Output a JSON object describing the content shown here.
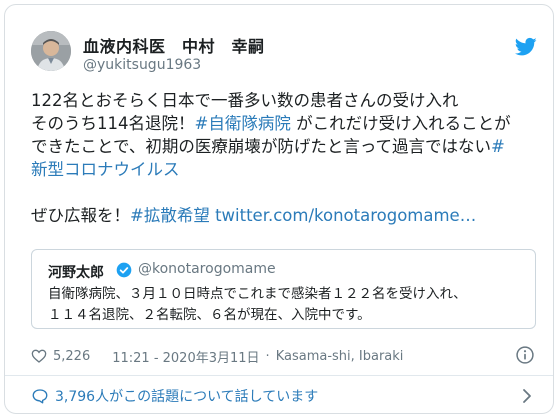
{
  "author": {
    "name": "血液内科医　中村　幸嗣",
    "handle": "@yukitsugu1963"
  },
  "tweet": {
    "line1": "122名とおそらく日本で一番多い数の患者さんの受け入れ",
    "line2_prefix": "そのうち114名退院！",
    "line2_hashtag": "#自衛隊病院",
    "line2_suffix": " がこれだけ受け入れることが",
    "line3_text": "できたことで、初期の医療崩壊が防げたと言って過言ではない",
    "line3_hashtag": "#",
    "line4_hashtag": "新型コロナウイルス",
    "line5_prefix": "ぜひ広報を！",
    "line5_hashtag": "#拡散希望",
    "line5_link": " twitter.com/konotarogomame…"
  },
  "quote": {
    "name": "河野太郎",
    "handle": "@konotarogomame",
    "line1": "自衛隊病院、３月１０日時点でこれまで感染者１２２名を受け入れ、",
    "line2": "１１４名退院、２名転院、６名が現在、入院中です。"
  },
  "meta": {
    "likes": "5,226",
    "time": "11:21 - 2020年3月11日",
    "separator": "·",
    "location": "Kasama-shi, Ibaraki"
  },
  "discussion": {
    "label": "3,796人がこの話題について話しています"
  },
  "icons": {
    "brand": "twitter-bird-icon",
    "verified": "verified-badge-icon",
    "like": "heart-icon",
    "info": "info-icon",
    "reply": "speech-bubble-icon",
    "chevron": "chevron-right-icon"
  },
  "colors": {
    "link": "#2b7bb9",
    "brand": "#1da1f2",
    "muted": "#697882",
    "text": "#1c2022"
  }
}
